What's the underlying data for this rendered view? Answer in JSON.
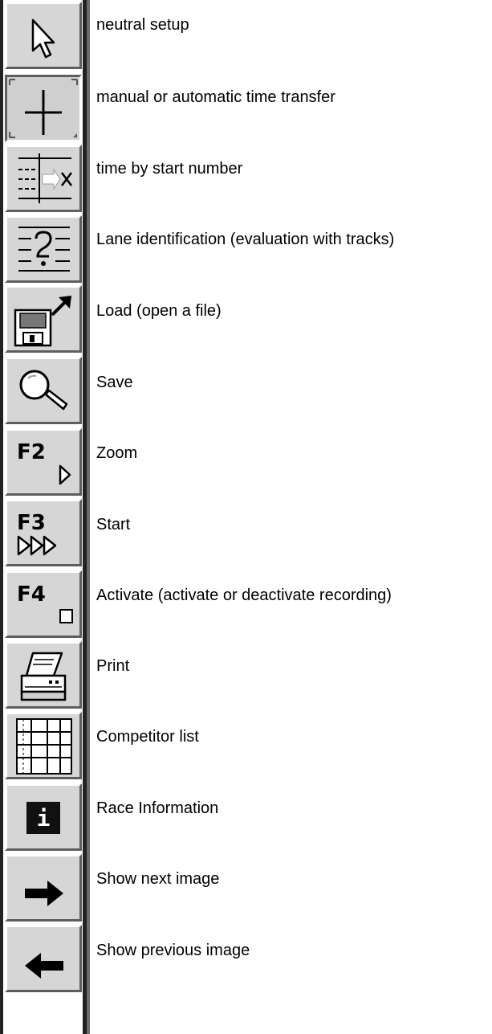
{
  "toolbar": {
    "buttons": [
      {
        "icon": "arrow-cursor-icon",
        "label": "neutral setup"
      },
      {
        "icon": "crosshair-icon",
        "label": "manual or automatic time transfer"
      },
      {
        "icon": "start-number-time-icon",
        "label": "time by start number"
      },
      {
        "icon": "lane-identification-icon",
        "label": "Lane identification (evaluation with tracks)"
      },
      {
        "icon": "floppy-load-icon",
        "label": "Load (open a file)"
      },
      {
        "icon": "magnifier-icon",
        "label": "Save"
      },
      {
        "icon": "f2-play-icon",
        "key": "F2",
        "label": "Zoom"
      },
      {
        "icon": "f3-fast-forward-icon",
        "key": "F3",
        "label": "Start"
      },
      {
        "icon": "f4-checkbox-icon",
        "key": "F4",
        "label": "Activate (activate or deactivate recording)"
      },
      {
        "icon": "printer-icon",
        "label": "Print"
      },
      {
        "icon": "table-grid-icon",
        "label": "Competitor list"
      },
      {
        "icon": "info-icon",
        "label": "Race Information"
      },
      {
        "icon": "right-arrow-icon",
        "label": "Show next image"
      },
      {
        "icon": "left-arrow-icon",
        "label": "Show previous image"
      }
    ]
  }
}
